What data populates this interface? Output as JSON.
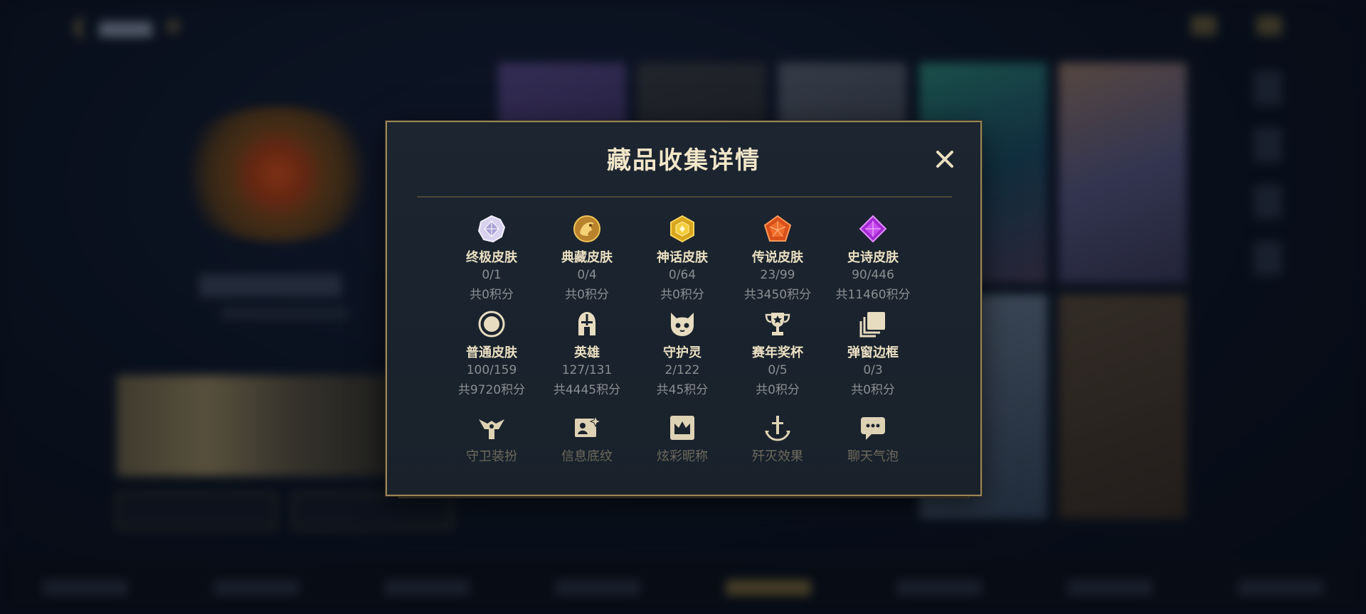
{
  "modal": {
    "title": "藏品收集详情",
    "close_icon": "close-icon"
  },
  "colors": {
    "accent_gold": "#c9a85e",
    "modal_border": "#9a8657",
    "text_primary": "#eae0c2",
    "text_secondary": "#8b8f92"
  },
  "items": [
    {
      "key": "ultimate",
      "icon": "ultimate-skin-icon",
      "name": "终极皮肤",
      "count": "0/1",
      "points": "共0积分"
    },
    {
      "key": "prestige",
      "icon": "prestige-skin-icon",
      "name": "典藏皮肤",
      "count": "0/4",
      "points": "共0积分"
    },
    {
      "key": "mythic",
      "icon": "mythic-skin-icon",
      "name": "神话皮肤",
      "count": "0/64",
      "points": "共0积分"
    },
    {
      "key": "legendary",
      "icon": "legendary-skin-icon",
      "name": "传说皮肤",
      "count": "23/99",
      "points": "共3450积分"
    },
    {
      "key": "epic",
      "icon": "epic-skin-icon",
      "name": "史诗皮肤",
      "count": "90/446",
      "points": "共11460积分"
    },
    {
      "key": "normal",
      "icon": "normal-skin-icon",
      "name": "普通皮肤",
      "count": "100/159",
      "points": "共9720积分"
    },
    {
      "key": "champion",
      "icon": "champion-helmet-icon",
      "name": "英雄",
      "count": "127/131",
      "points": "共4445积分"
    },
    {
      "key": "guardian",
      "icon": "guardian-spirit-icon",
      "name": "守护灵",
      "count": "2/122",
      "points": "共45积分"
    },
    {
      "key": "trophy",
      "icon": "trophy-icon",
      "name": "赛年奖杯",
      "count": "0/5",
      "points": "共0积分"
    },
    {
      "key": "border",
      "icon": "popup-border-icon",
      "name": "弹窗边框",
      "count": "0/3",
      "points": "共0积分"
    },
    {
      "key": "ward",
      "icon": "ward-skin-icon",
      "name": "守卫装扮"
    },
    {
      "key": "banner",
      "icon": "profile-banner-icon",
      "name": "信息底纹"
    },
    {
      "key": "nickname",
      "icon": "colored-nickname-icon",
      "name": "炫彩昵称"
    },
    {
      "key": "finisher",
      "icon": "finisher-effect-icon",
      "name": "歼灭效果"
    },
    {
      "key": "chat",
      "icon": "chat-bubble-icon",
      "name": "聊天气泡"
    }
  ]
}
